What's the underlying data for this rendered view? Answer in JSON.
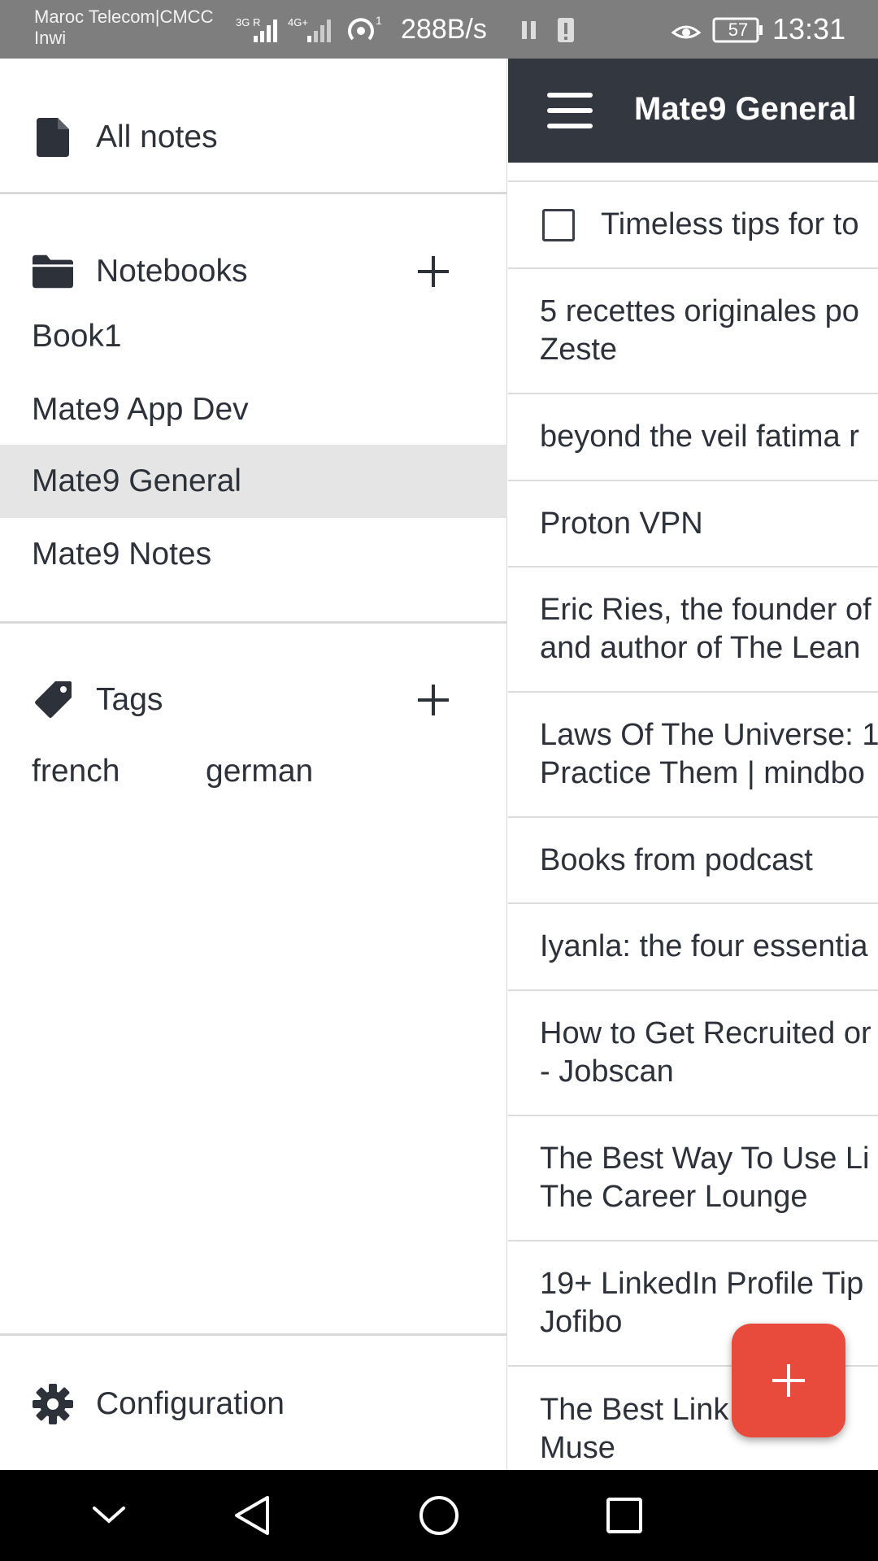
{
  "status_bar": {
    "carrier_line1": "Maroc Telecom|CMCC",
    "carrier_line2": "Inwi",
    "net_rate": "288B/s",
    "battery": "57",
    "time": "13:31"
  },
  "drawer": {
    "all_notes_label": "All notes",
    "notebooks_label": "Notebooks",
    "notebooks": [
      "Book1",
      "Mate9 App Dev",
      "Mate9 General",
      "Mate9 Notes"
    ],
    "selected_notebook": "Mate9 General",
    "tags_label": "Tags",
    "tags": [
      "french",
      "german"
    ],
    "configuration_label": "Configuration"
  },
  "notes_panel": {
    "title": "Mate9 General",
    "notes": [
      {
        "line1": "Timeless tips for to",
        "line2": "",
        "todo": true
      },
      {
        "line1": "5 recettes originales po",
        "line2": "Zeste",
        "todo": false
      },
      {
        "line1": "beyond the veil fatima r",
        "line2": "",
        "todo": false
      },
      {
        "line1": "Proton VPN",
        "line2": "",
        "todo": false
      },
      {
        "line1": "Eric Ries, the founder of",
        "line2": "and author of The Lean",
        "todo": false
      },
      {
        "line1": "Laws Of The Universe: 1",
        "line2": "Practice Them | mindbo",
        "todo": false
      },
      {
        "line1": "Books from podcast",
        "line2": "",
        "todo": false
      },
      {
        "line1": "Iyanla: the four essentia",
        "line2": "",
        "todo": false
      },
      {
        "line1": "How to Get Recruited or",
        "line2": "- Jobscan",
        "todo": false
      },
      {
        "line1": "The Best Way To Use Li",
        "line2": "The Career Lounge",
        "todo": false
      },
      {
        "line1": "19+ LinkedIn Profile Tip",
        "line2": "Jofibo",
        "todo": false
      },
      {
        "line1": "The Best Link     ofil",
        "line2": "Muse",
        "todo": false
      }
    ]
  },
  "colors": {
    "app_bar": "#333740",
    "fab": "#e84a3b",
    "selected_row": "#e5e5e5",
    "status_bar": "#7e7e7e"
  },
  "icons": {
    "all_notes": "file-icon",
    "notebooks": "folder-icon",
    "tags": "tag-icon",
    "configuration": "gear-icon",
    "fab": "plus-icon"
  }
}
